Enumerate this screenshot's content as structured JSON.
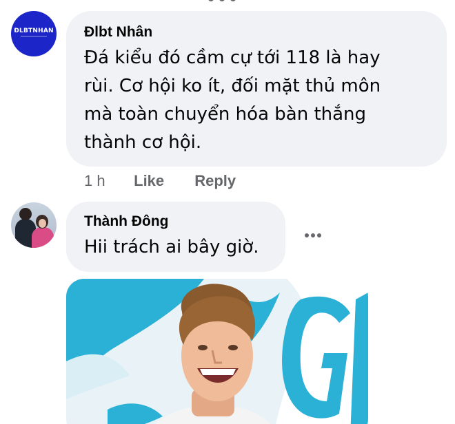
{
  "comments": [
    {
      "author": "Đlbt Nhân",
      "avatar_text": "ĐLBTNHAN",
      "text_lines": [
        "Đá kiểu đó cầm cự tới 118 là hay",
        "rùi. Cơ hội ko ít, đối mặt thủ môn",
        "mà toàn chuyển hóa bàn thắng",
        "thành cơ hội."
      ],
      "time": "1 h",
      "like_label": "Like",
      "reply_label": "Reply"
    },
    {
      "author": "Thành Đông",
      "text": "Hii trách ai bây giờ."
    }
  ],
  "colors": {
    "bubble": "#f0f2f5",
    "text": "#050505",
    "secondary": "#65676b",
    "avatar_brand": "#1c25c7",
    "photo_accent": "#2bb0d6"
  },
  "icons": {
    "more": "more-horizontal-icon"
  }
}
